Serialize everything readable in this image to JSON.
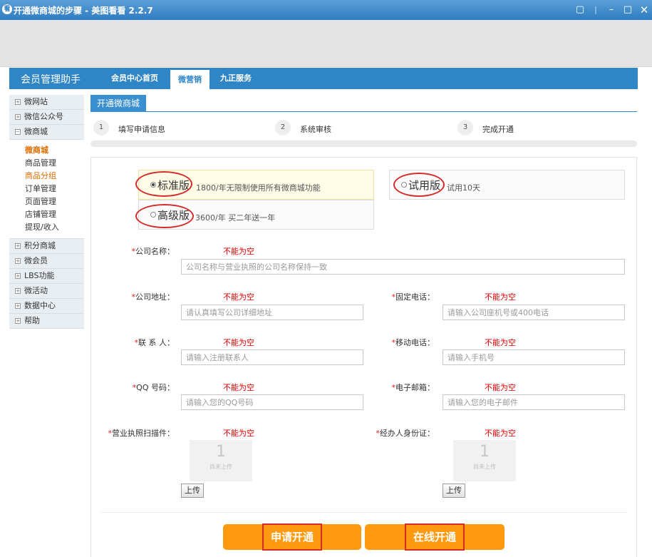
{
  "window": {
    "title": "开通微商城的步骤 - 美图看看 2.2.7",
    "app_icon_char": "看"
  },
  "header": {
    "brand": "会员管理助手",
    "nav": [
      {
        "label": "会员中心首页"
      },
      {
        "label": "微营销"
      },
      {
        "label": "九正服务"
      }
    ]
  },
  "sidebar": {
    "items_top": [
      "微网站",
      "微信公众号",
      "微商城"
    ],
    "submenu": [
      "微商城",
      "商品管理",
      "商品分组",
      "订单管理",
      "页面管理",
      "店铺管理",
      "提现/收入"
    ],
    "items_bottom": [
      "积分商城",
      "微会员",
      "LBS功能",
      "微活动",
      "数据中心",
      "帮助"
    ],
    "expand_plus": "+",
    "expand_minus": "−"
  },
  "tab": {
    "label": "开通微商城"
  },
  "steps": [
    {
      "num": "1",
      "label": "填写申请信息"
    },
    {
      "num": "2",
      "label": "系统审核"
    },
    {
      "num": "3",
      "label": "完成开通"
    }
  ],
  "plans": {
    "standard": {
      "name": "标准版",
      "desc": "1800/年无限制使用所有微商城功能"
    },
    "trial": {
      "name": "试用版",
      "desc": "试用10天"
    },
    "advanced": {
      "name": "高级版",
      "desc": "3600/年 买二年送一年"
    }
  },
  "form": {
    "required_mark": "*",
    "error_text": "不能为空",
    "company_name": {
      "label": "公司名称：",
      "placeholder": "公司名称与营业执照的公司名称保持一致"
    },
    "company_address": {
      "label": "公司地址：",
      "placeholder": "请认真填写公司详细地址"
    },
    "landline": {
      "label": "固定电话：",
      "placeholder": "请输入公司座机号或400电话"
    },
    "contact": {
      "label": "联 系 人：",
      "placeholder": "请输入注册联系人"
    },
    "mobile": {
      "label": "移动电话：",
      "placeholder": "请输入手机号"
    },
    "qq": {
      "label": "QQ 号码：",
      "placeholder": "请输入您的QQ号码"
    },
    "email": {
      "label": "电子邮箱：",
      "placeholder": "请输入您的电子邮件"
    },
    "license": {
      "label": "营业执照扫描件：",
      "thumb_num": "1",
      "thumb_text": "尚未上传",
      "upload": "上传"
    },
    "id_card": {
      "label": "经办人身份证：",
      "thumb_num": "1",
      "thumb_text": "尚未上传",
      "upload": "上传"
    }
  },
  "actions": {
    "apply": "申请开通",
    "online": "在线开通"
  }
}
